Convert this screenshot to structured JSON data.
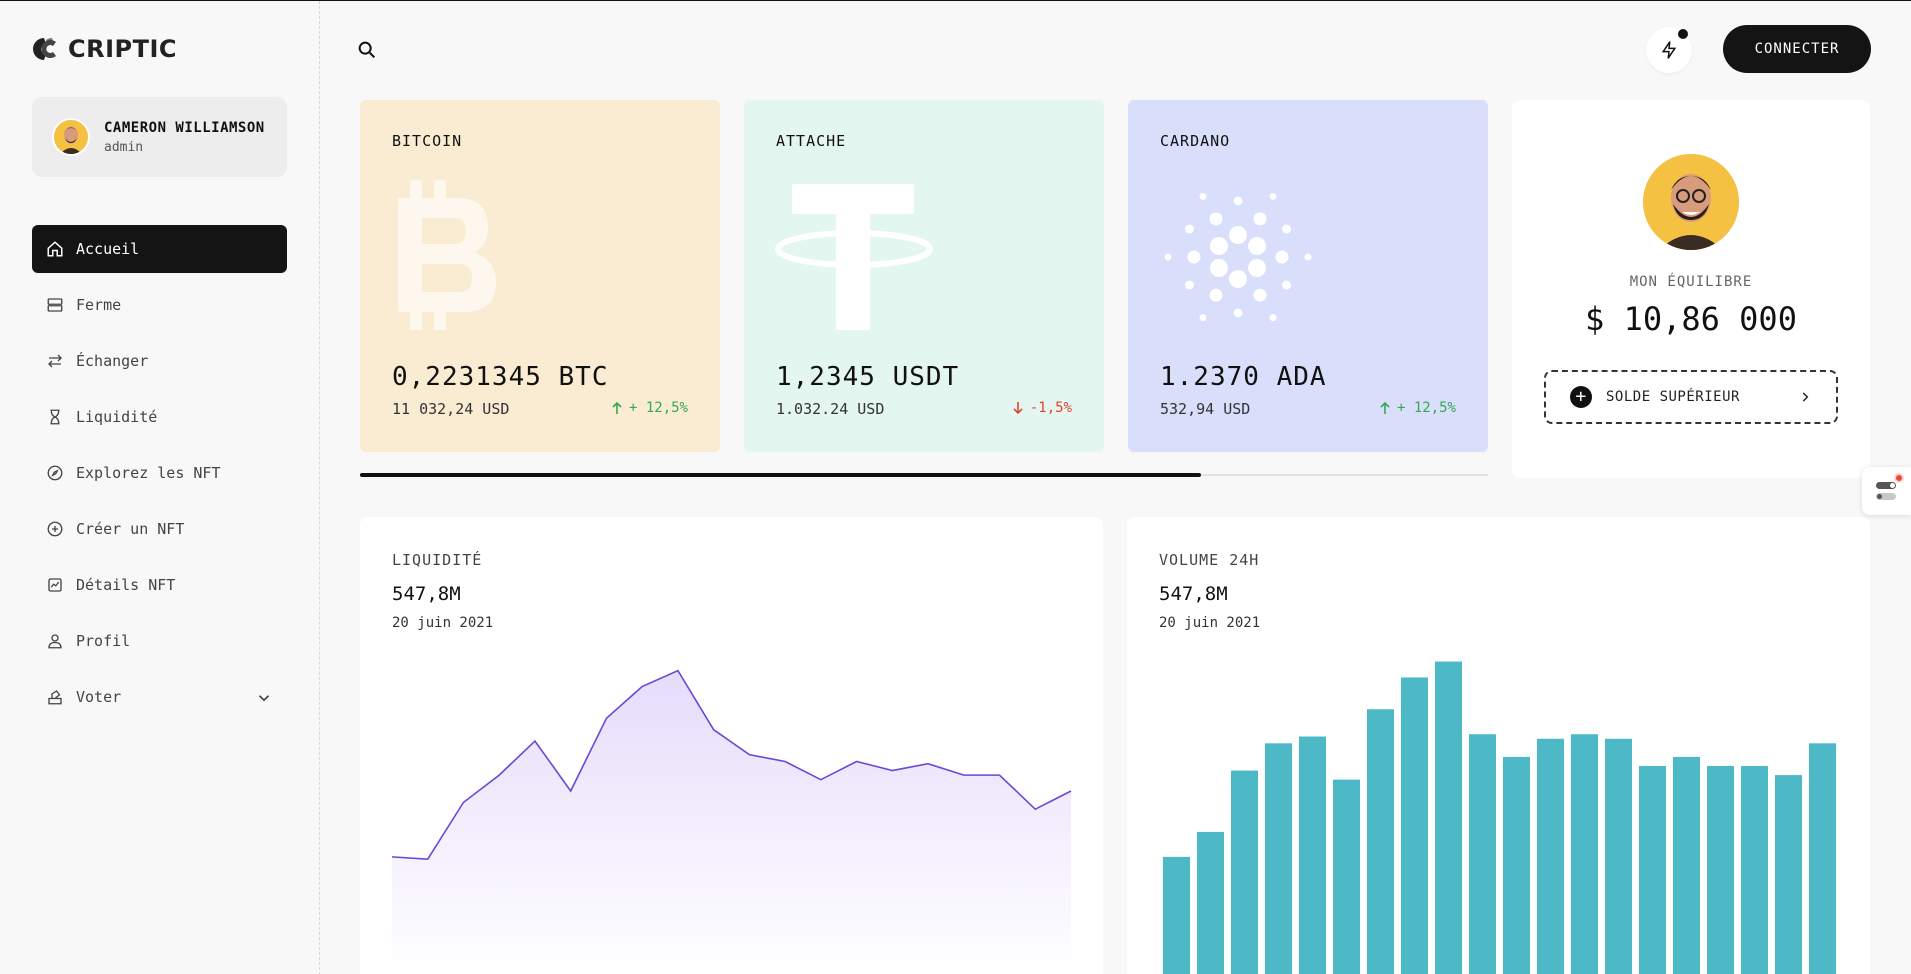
{
  "app": {
    "name": "CRIPTIC"
  },
  "user": {
    "name": "CAMERON WILLIAMSON",
    "role": "admin"
  },
  "nav": [
    {
      "label": "Accueil",
      "icon": "home-icon",
      "active": true
    },
    {
      "label": "Ferme",
      "icon": "server-icon"
    },
    {
      "label": "Échanger",
      "icon": "swap-icon"
    },
    {
      "label": "Liquidité",
      "icon": "hourglass-icon"
    },
    {
      "label": "Explorez les NFT",
      "icon": "compass-icon"
    },
    {
      "label": "Créer un NFT",
      "icon": "plus-circle-icon"
    },
    {
      "label": "Détails NFT",
      "icon": "chart-box-icon"
    },
    {
      "label": "Profil",
      "icon": "user-icon"
    },
    {
      "label": "Voter",
      "icon": "vote-icon",
      "has_submenu": true
    }
  ],
  "header": {
    "connect_label": "CONNECTER"
  },
  "coins": [
    {
      "name": "BITCOIN",
      "amount": "0,2231345 BTC",
      "usd": "11 032,24 USD",
      "change": "+ 12,5%",
      "direction": "up",
      "bg": "#faecd2",
      "icon": "bitcoin-icon"
    },
    {
      "name": "ATTACHE",
      "amount": "1,2345 USDT",
      "usd": "1.032.24 USD",
      "change": "-1,5%",
      "direction": "down",
      "bg": "#e3f6ef",
      "icon": "tether-icon"
    },
    {
      "name": "CARDANO",
      "amount": "1.2370 ADA",
      "usd": "532,94 USD",
      "change": "+ 12,5%",
      "direction": "up",
      "bg": "#d9defb",
      "icon": "cardano-icon"
    }
  ],
  "carousel": {
    "progress": 0.746
  },
  "balance": {
    "label": "MON ÉQUILIBRE",
    "value": "$ 10,86 000",
    "top_up_label": "SOLDE SUPÉRIEUR"
  },
  "liquidity": {
    "title": "LIQUIDITÉ",
    "value": "547,8M",
    "date": "20 juin 2021",
    "chart_data": {
      "type": "area",
      "values": [
        20,
        19,
        44,
        56,
        71,
        49,
        81,
        95,
        102,
        76,
        65,
        62,
        54,
        62,
        58,
        61,
        56,
        56,
        41,
        49
      ],
      "ylim": [
        -32,
        108
      ],
      "color": "#6b46d8",
      "fill": "#e5dcfb"
    }
  },
  "volume": {
    "title": "VOLUME 24H",
    "value": "547,8M",
    "date": "20 juin 2021",
    "chart_data": {
      "type": "bar",
      "values": [
        20,
        31,
        58,
        70,
        73,
        54,
        85,
        99,
        106,
        74,
        64,
        72,
        74,
        72,
        60,
        64,
        60,
        60,
        56,
        70
      ],
      "ylim": [
        -32,
        108
      ],
      "color": "#4db8c6"
    }
  }
}
